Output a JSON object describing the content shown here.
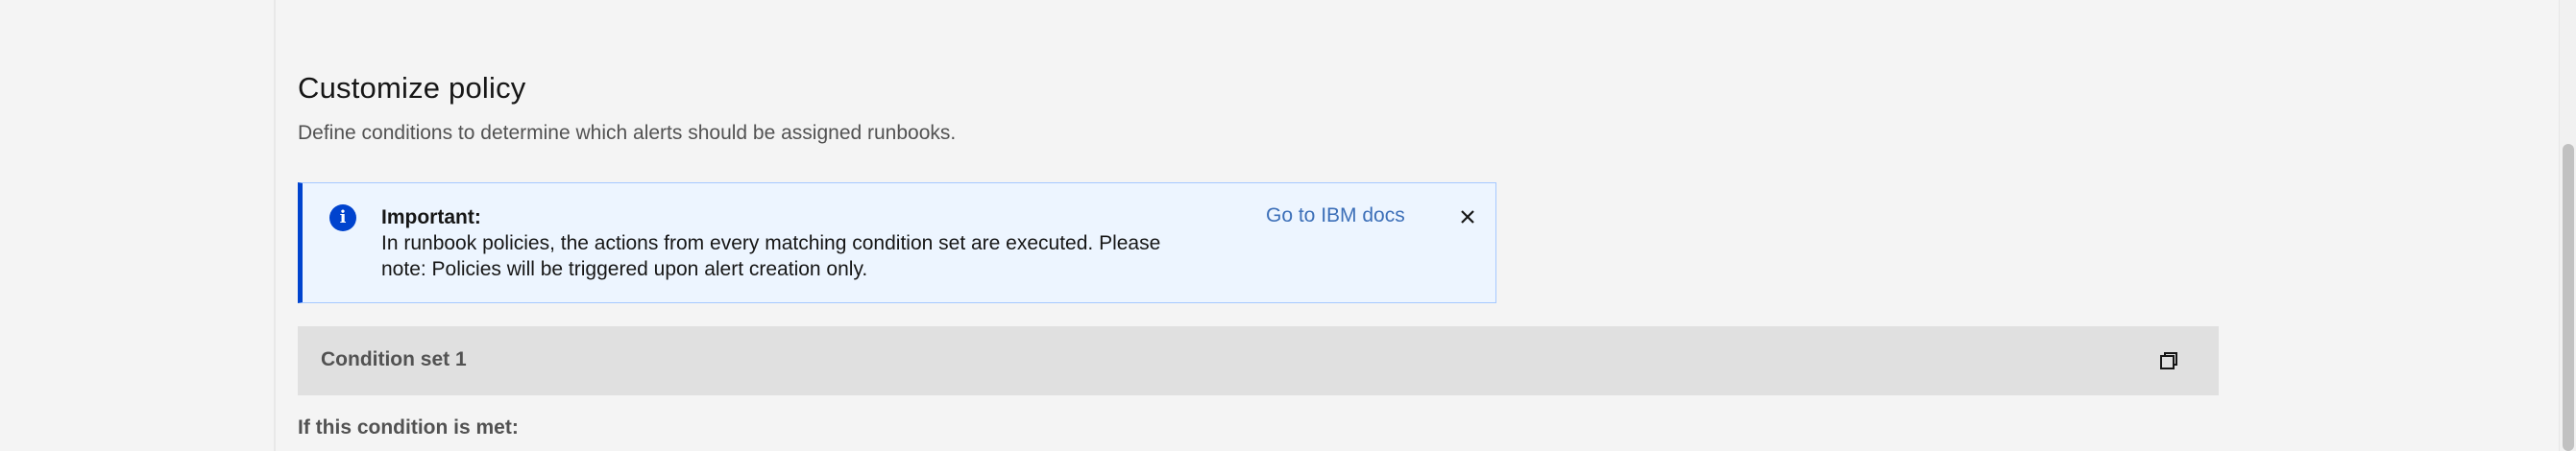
{
  "section": {
    "title": "Customize policy",
    "subtitle": "Define conditions to determine which alerts should be assigned runbooks."
  },
  "notification": {
    "kind": "info",
    "icon": "info-icon",
    "heading": "Important:",
    "body": "In runbook policies, the actions from every matching condition set are executed. Please note: Policies will be triggered upon alert creation only.",
    "link_label": "Go to IBM docs",
    "close_icon": "close-icon",
    "accent_color": "#0043ce",
    "background_color": "#edf5ff"
  },
  "condition_set": {
    "title": "Condition set 1",
    "copy_icon": "copy-icon",
    "condition_label": "If this condition is met:"
  }
}
